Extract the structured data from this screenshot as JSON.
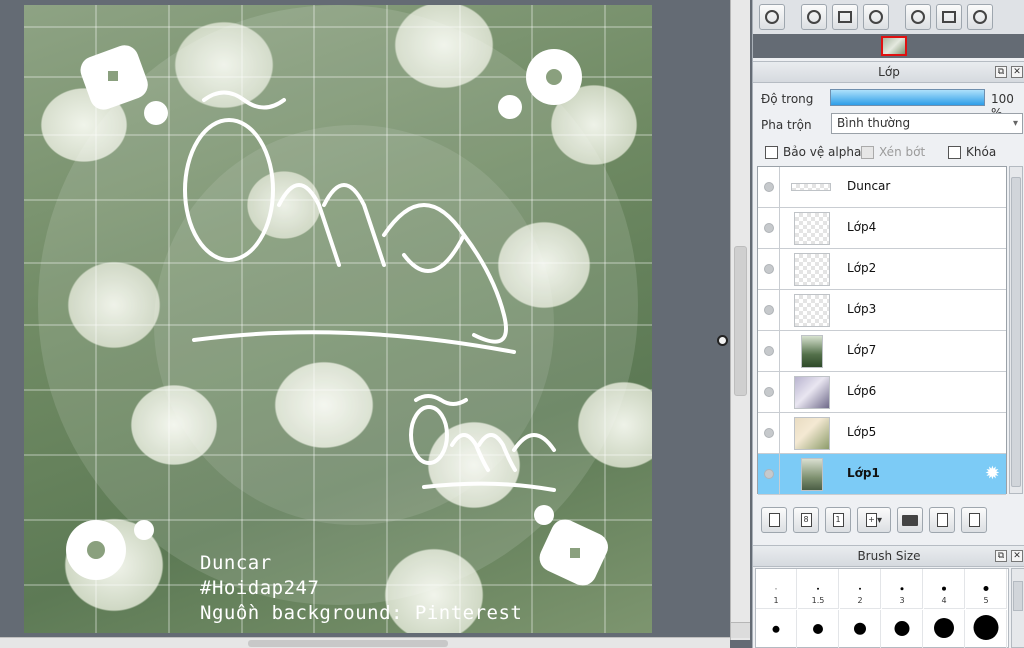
{
  "canvas": {
    "credits": [
      "Duncar",
      "#Hoidap247",
      "Nguồn background: Pinterest"
    ]
  },
  "navigator": {
    "buttons": [
      "zoom-fit-icon",
      "zoom-in-icon",
      "fit-screen-icon",
      "zoom-out-icon",
      "rotate-left-icon",
      "actual-size-icon",
      "rotate-right-icon"
    ]
  },
  "layer_panel": {
    "title": "Lớp",
    "opacity_label": "Độ trong",
    "opacity_value": "100 %",
    "opacity_fraction": 1.0,
    "blend_label": "Pha trộn",
    "blend_value": "Bình thường",
    "protect_alpha_label": "Bảo vệ alpha",
    "clip_label": "Xén bớt",
    "lock_label": "Khóa",
    "layers": [
      {
        "name": "Duncar",
        "selected": false
      },
      {
        "name": "Lớp4",
        "selected": false
      },
      {
        "name": "Lớp2",
        "selected": false
      },
      {
        "name": "Lớp3",
        "selected": false
      },
      {
        "name": "Lớp7",
        "selected": false
      },
      {
        "name": "Lớp6",
        "selected": false
      },
      {
        "name": "Lớp5",
        "selected": false
      },
      {
        "name": "Lớp1",
        "selected": true
      }
    ]
  },
  "brush_panel": {
    "title": "Brush Size",
    "sizes": [
      "1",
      "1.5",
      "2",
      "3",
      "4",
      "5"
    ]
  },
  "colors": {
    "selection": "#7ccbf6",
    "opacity_bar": "#2e9ee8",
    "navigator_frame": "#e01010"
  }
}
